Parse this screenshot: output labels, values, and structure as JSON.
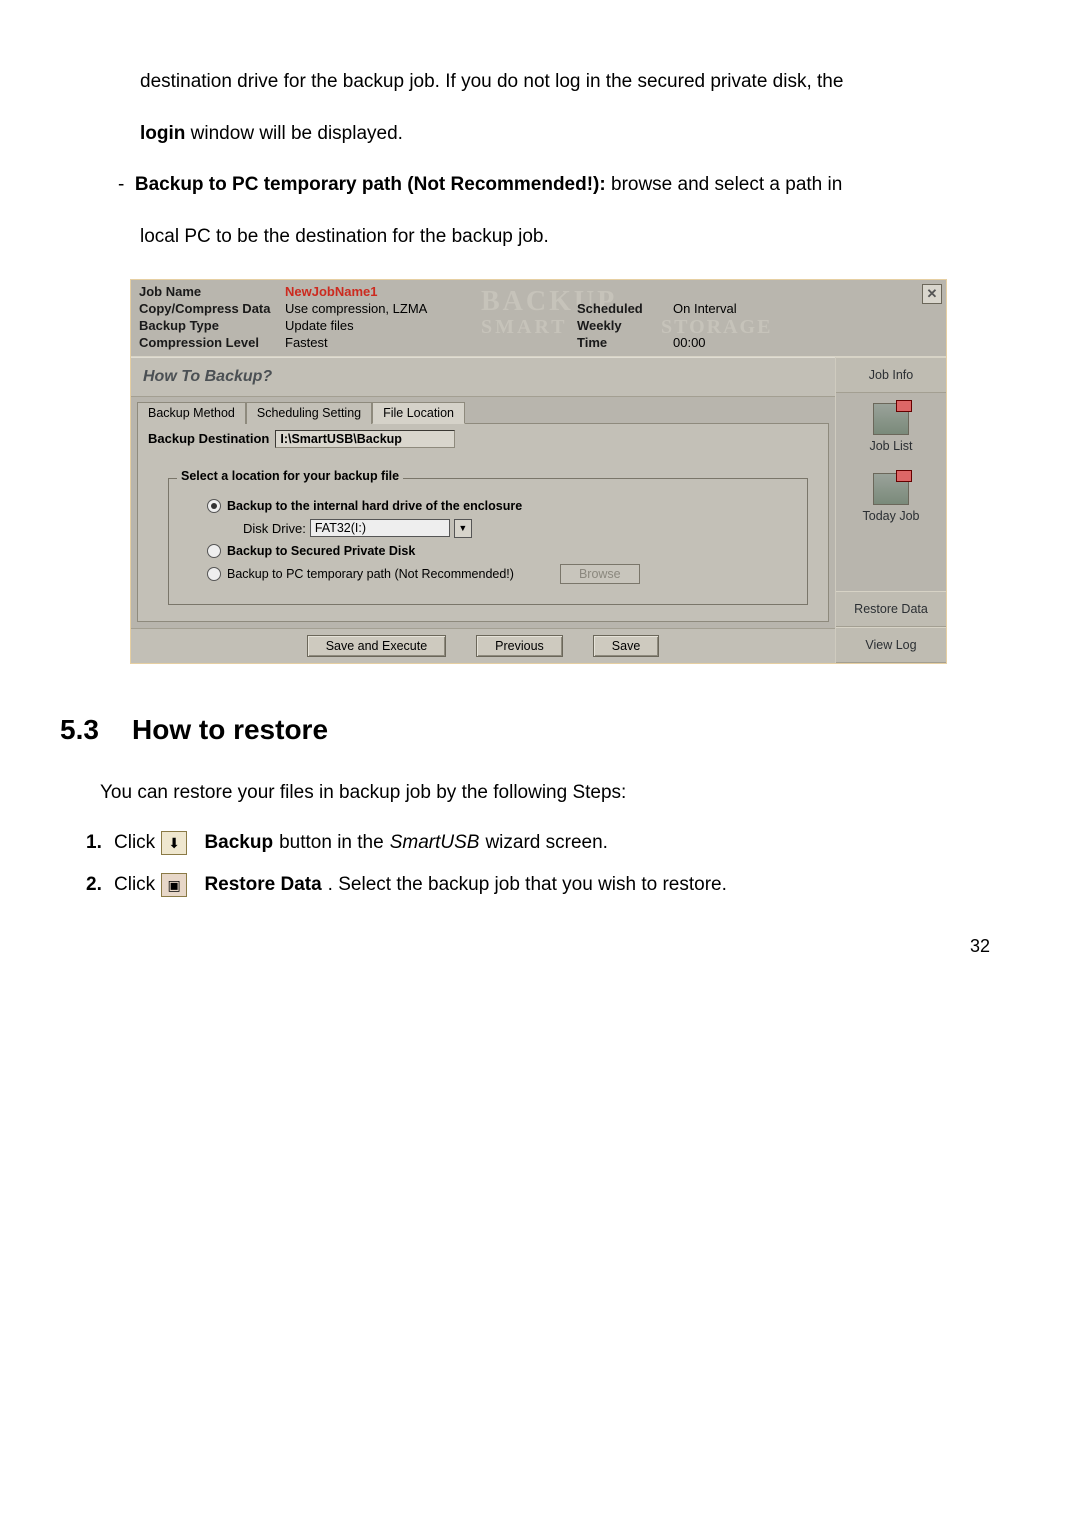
{
  "intro": {
    "line1a": "destination drive for the backup job. If you do not log in the secured private disk, the",
    "line1b_bold": "login",
    "line1b_rest": " window will be displayed.",
    "dash": "-",
    "bullet_bold": "Backup to PC temporary path (Not Recommended!):",
    "bullet_rest": " browse and select a path in",
    "bullet_line2": "local PC to be the destination for the backup job."
  },
  "win": {
    "top": {
      "job_name_lbl": "Job Name",
      "job_name_val": "NewJobName1",
      "copy_lbl": "Copy/Compress Data",
      "copy_val": "Use compression, LZMA",
      "backup_type_lbl": "Backup Type",
      "backup_type_val": "Update files",
      "comp_lbl": "Compression Level",
      "comp_val": "Fastest",
      "sched_lbl": "Scheduled",
      "sched_val": "On Interval",
      "weekly_lbl": "Weekly",
      "time_lbl": "Time",
      "time_val": "00:00",
      "wm1": "BACKUP",
      "wm2": "SMART",
      "wm3": "STORAGE",
      "close": "✕"
    },
    "section_title": "How To Backup?",
    "tabs": {
      "t1": "Backup Method",
      "t2": "Scheduling Setting",
      "t3": "File Location"
    },
    "dest_lbl": "Backup Destination",
    "dest_val": "I:\\SmartUSB\\Backup",
    "group_legend": "Select a location for your backup file",
    "opt1": "Backup to the internal hard drive of the enclosure",
    "dd_lbl": "Disk Drive:",
    "dd_val": "FAT32(I:)",
    "opt2": "Backup to Secured Private Disk",
    "opt3": "Backup to PC temporary path (Not Recommended!)",
    "browse": "Browse",
    "btns": {
      "save_exec": "Save and Execute",
      "prev": "Previous",
      "save": "Save"
    },
    "side": {
      "jobinfo": "Job Info",
      "joblist": "Job List",
      "todayjob": "Today Job",
      "restore": "Restore Data",
      "viewlog": "View Log"
    }
  },
  "h2": {
    "num": "5.3",
    "title": "How to restore"
  },
  "after": {
    "intro": "You can restore your files in backup job by the following Steps:",
    "s1_num": "1.",
    "s1_a": "Click ",
    "s1_bold": "Backup",
    "s1_b": " button in the ",
    "s1_ital": "SmartUSB",
    "s1_c": " wizard screen.",
    "s2_num": "2.",
    "s2_a": "Click ",
    "s2_bold": "Restore Data",
    "s2_b": ". Select the backup job that you wish to restore."
  },
  "page_number": "32"
}
